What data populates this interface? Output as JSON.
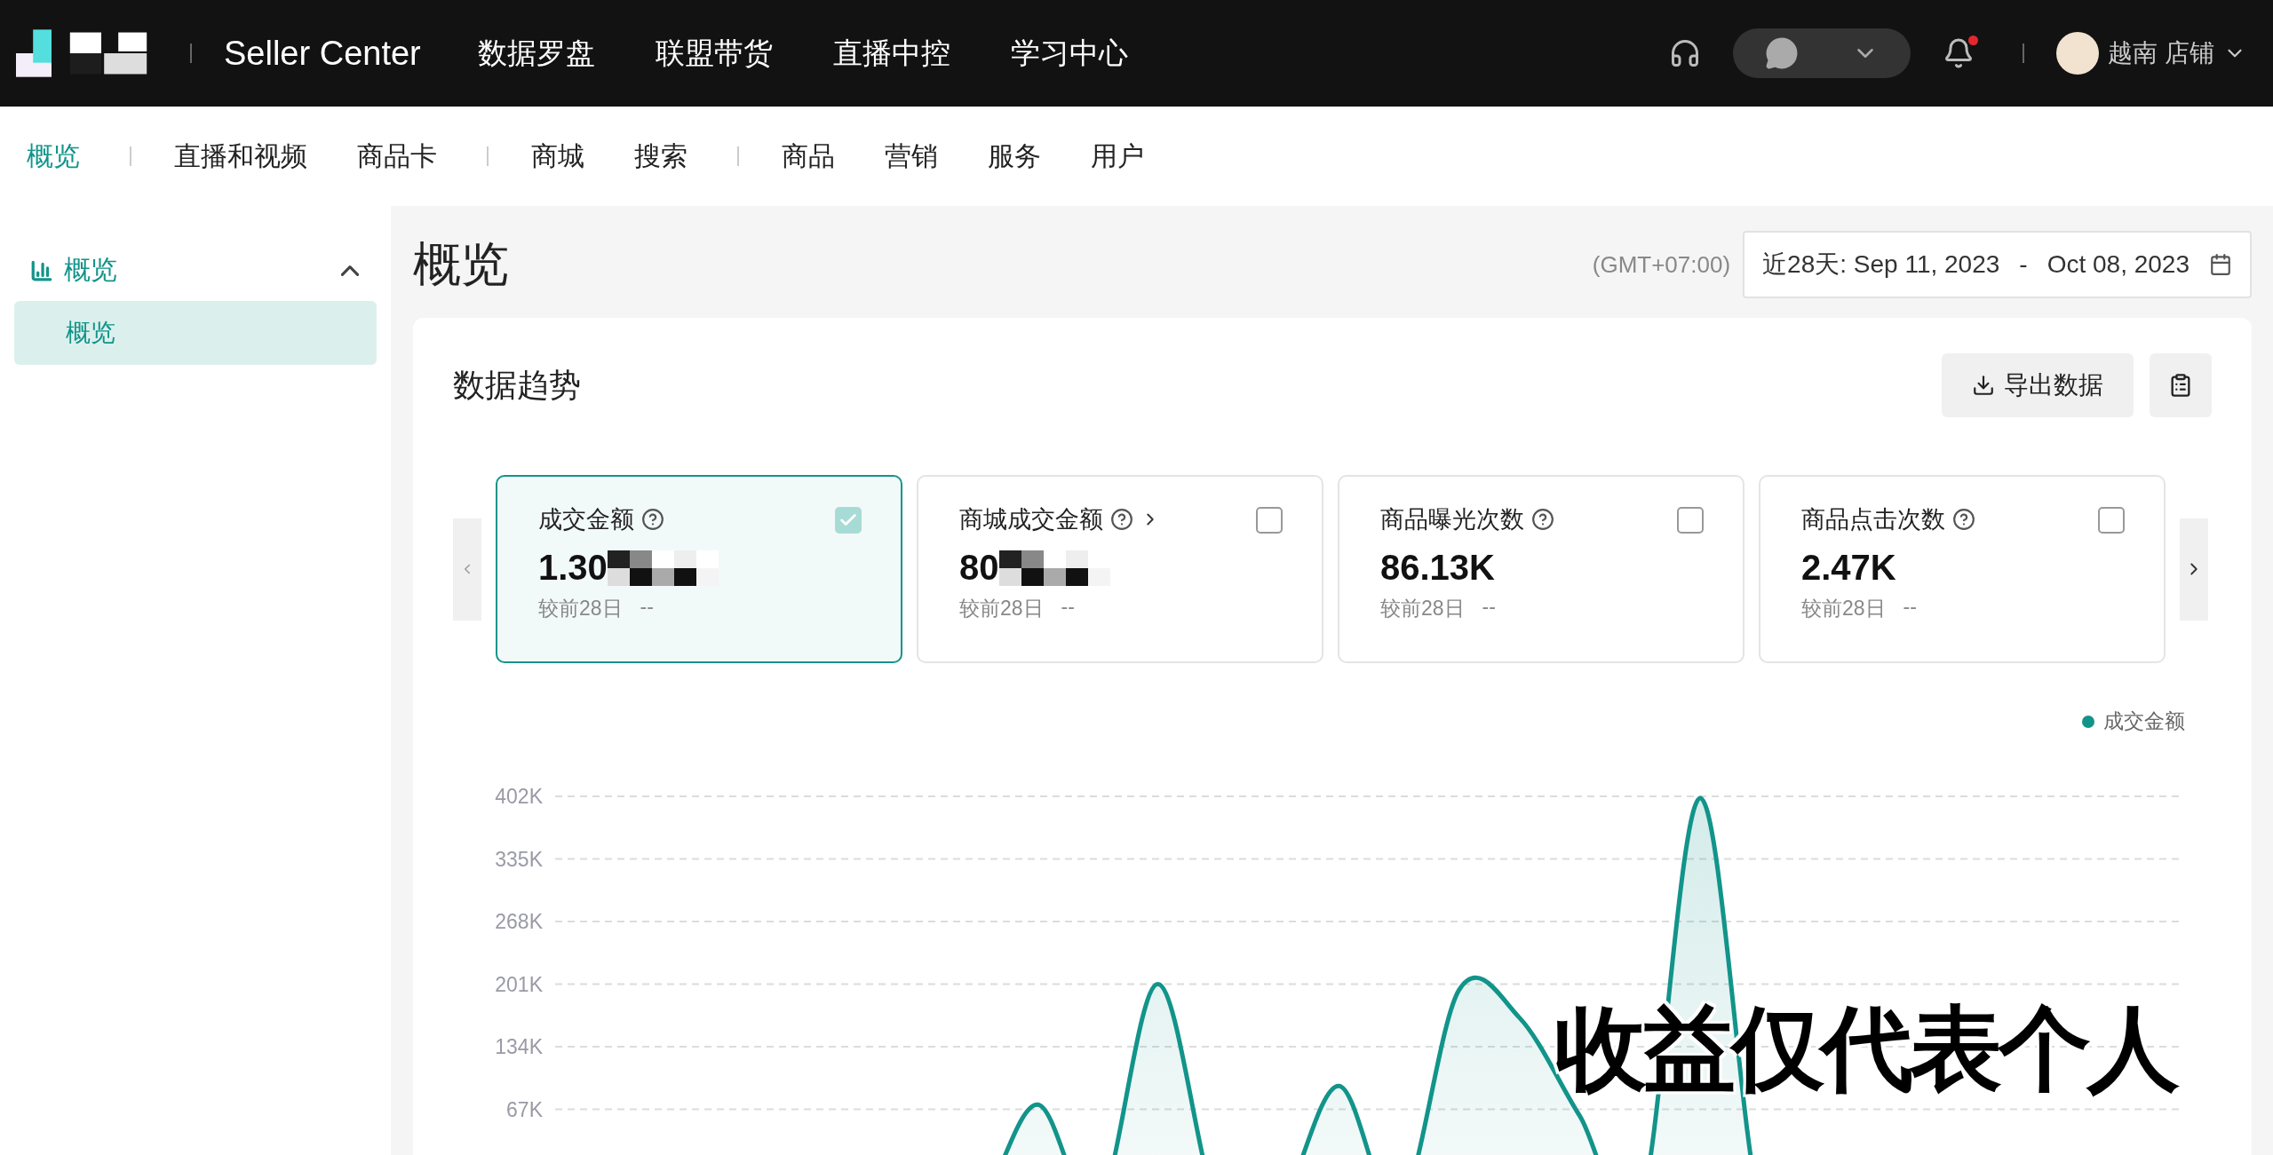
{
  "top_bar": {
    "title": "Seller Center",
    "nav": [
      "数据罗盘",
      "联盟带货",
      "直播中控",
      "学习中心"
    ],
    "notifications_unread": true,
    "account": "越南 店铺"
  },
  "sub_nav": [
    [
      {
        "label": "概览",
        "selected": true
      }
    ],
    [
      {
        "label": "直播和视频",
        "selected": false
      },
      {
        "label": "商品卡",
        "selected": false
      }
    ],
    [
      {
        "label": "商城",
        "selected": false
      },
      {
        "label": "搜索",
        "selected": false
      }
    ],
    [
      {
        "label": "商品",
        "selected": false
      },
      {
        "label": "营销",
        "selected": false
      },
      {
        "label": "服务",
        "selected": false
      },
      {
        "label": "用户",
        "selected": false
      }
    ]
  ],
  "sidebar": {
    "label": "概览",
    "expanded": true,
    "children": [
      {
        "label": "概览",
        "selected": true
      }
    ]
  },
  "page": {
    "title": "概览",
    "timezone": "(GMT+07:00)",
    "date_range": {
      "prefix": "近28天:",
      "start": "Sep 11, 2023",
      "separator": "-",
      "end": "Oct 08, 2023"
    }
  },
  "trend": {
    "title": "数据趋势",
    "export_button": "导出数据",
    "metrics": [
      {
        "label": "成交金额",
        "has_link": false,
        "value": "1.30",
        "redacted": true,
        "compare_label": "较前28日",
        "compare_value": "--",
        "selected": true
      },
      {
        "label": "商城成交金额",
        "has_link": true,
        "value": "80",
        "redacted": true,
        "compare_label": "较前28日",
        "compare_value": "--",
        "selected": false
      },
      {
        "label": "商品曝光次数",
        "has_link": false,
        "value": "86.13K",
        "redacted": false,
        "compare_label": "较前28日",
        "compare_value": "--",
        "selected": false
      },
      {
        "label": "商品点击次数",
        "has_link": false,
        "value": "2.47K",
        "redacted": false,
        "compare_label": "较前28日",
        "compare_value": "--",
        "selected": false
      }
    ],
    "chart": {
      "legend": "成交金额",
      "y_axis_labels": [
        "402K",
        "335K",
        "268K",
        "201K",
        "134K",
        "67K"
      ]
    }
  },
  "overlay_caption": "收益仅代表个人"
}
